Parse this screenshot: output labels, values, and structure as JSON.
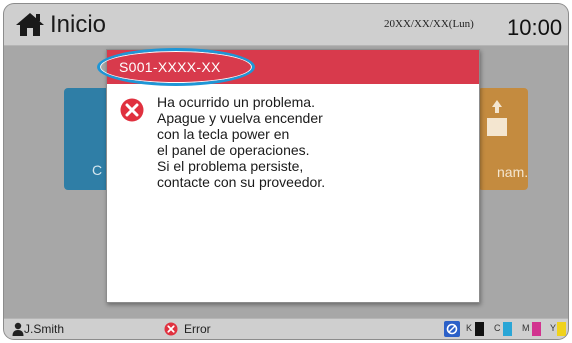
{
  "header": {
    "home_icon": "home-icon",
    "title": "Inicio",
    "date": "20XX/XX/XX(Lun)",
    "time": "10:00"
  },
  "background_tiles": {
    "left_label": "C",
    "right_label": "nam."
  },
  "dialog": {
    "error_code": "S001-XXXX-XX",
    "error_icon": "error-circle-icon",
    "message_lines": [
      "Ha ocurrido un problema.",
      "Apague y vuelva encender",
      "con la tecla power en",
      "el panel de operaciones.",
      "Si el problema persiste,",
      "contacte con su proveedor."
    ]
  },
  "statusbar": {
    "user": "J.Smith",
    "status": "Error",
    "ink": [
      {
        "label": "K",
        "color": "#111111"
      },
      {
        "label": "C",
        "color": "#2aa6d6"
      },
      {
        "label": "M",
        "color": "#d2338f"
      },
      {
        "label": "Y",
        "color": "#f0d21c"
      }
    ]
  },
  "colors": {
    "header_red": "#d83a4c",
    "highlight_blue": "#1e96d6",
    "error_red": "#e0313f"
  }
}
